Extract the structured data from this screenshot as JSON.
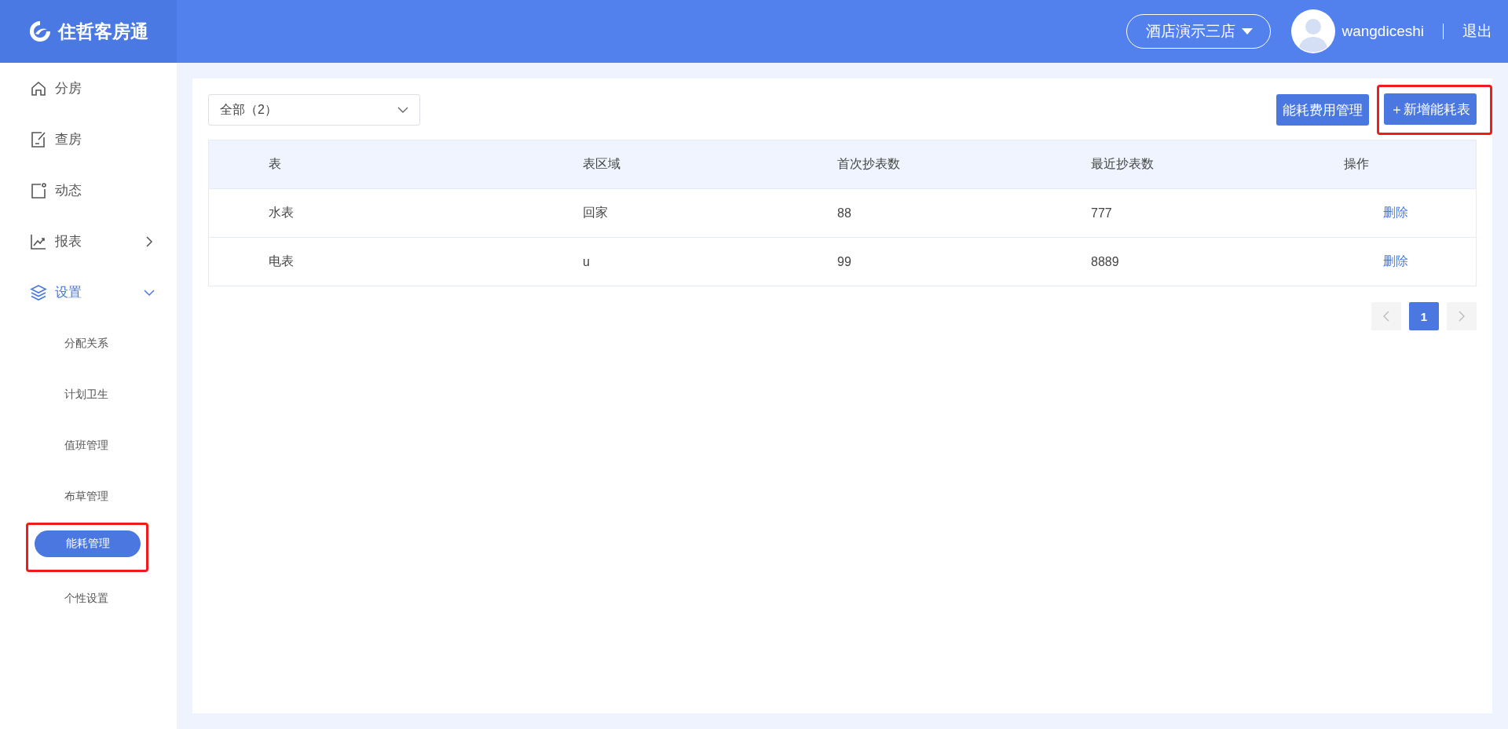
{
  "header": {
    "logo_text": "住哲客房通",
    "store_selector": "酒店演示三店",
    "username": "wangdiceshi",
    "logout": "退出"
  },
  "sidebar": {
    "items": [
      {
        "label": "分房",
        "kind": "link",
        "selected": false
      },
      {
        "label": "查房",
        "kind": "link",
        "selected": false
      },
      {
        "label": "动态",
        "kind": "link",
        "selected": false
      },
      {
        "label": "报表",
        "kind": "group",
        "selected": false,
        "expanded": false
      },
      {
        "label": "设置",
        "kind": "group",
        "selected": true,
        "expanded": true,
        "children": [
          {
            "label": "分配关系",
            "selected": false,
            "highlighted": false
          },
          {
            "label": "计划卫生",
            "selected": false,
            "highlighted": false
          },
          {
            "label": "值班管理",
            "selected": false,
            "highlighted": false
          },
          {
            "label": "布草管理",
            "selected": false,
            "highlighted": false
          },
          {
            "label": "能耗管理",
            "selected": true,
            "highlighted": true
          },
          {
            "label": "个性设置",
            "selected": false,
            "highlighted": false
          }
        ]
      }
    ]
  },
  "filter": {
    "value": "全部（2）"
  },
  "toolbar_buttons": [
    {
      "label": "能耗费用管理",
      "highlighted": false
    },
    {
      "label": "＋新增能耗表",
      "highlighted": true
    }
  ],
  "table": {
    "columns": [
      "表",
      "表区域",
      "首次抄表数",
      "最近抄表数",
      "操作"
    ],
    "rows": [
      {
        "cells": [
          "水表",
          "回家",
          "88",
          "777"
        ],
        "action": "删除"
      },
      {
        "cells": [
          "电表",
          "u",
          "99",
          "8889"
        ],
        "action": "删除"
      }
    ]
  },
  "pagination": {
    "prev_disabled": true,
    "next_disabled": true,
    "pages": [
      {
        "label": "1",
        "selected": true
      }
    ]
  }
}
